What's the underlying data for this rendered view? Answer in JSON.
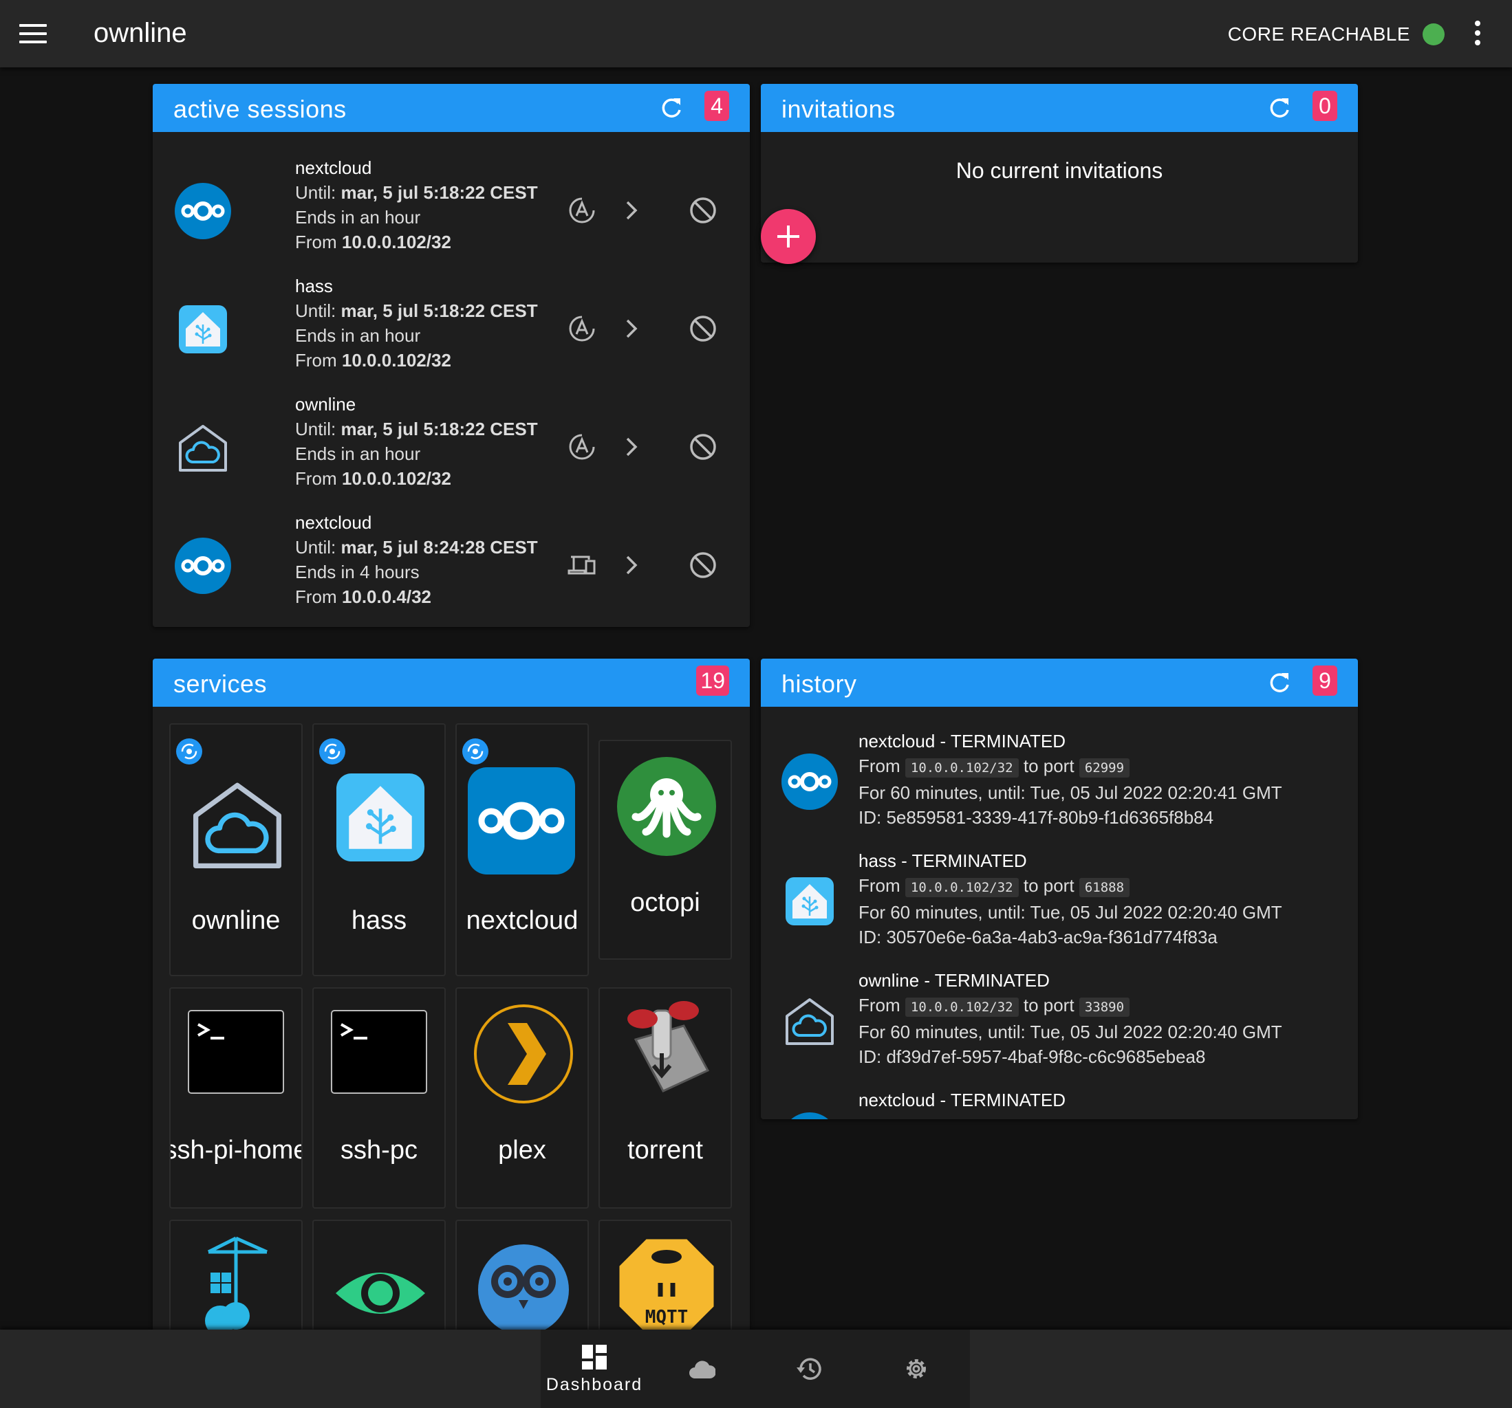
{
  "app": {
    "title": "ownline",
    "status": "CORE REACHABLE",
    "status_color": "#4caf50"
  },
  "colors": {
    "accent": "#2196f3",
    "badge": "#f0396e",
    "background": "#121212"
  },
  "active_sessions": {
    "title": "active sessions",
    "count": "4",
    "items": [
      {
        "name": "nextcloud",
        "until_label": "Until:",
        "until": "mar, 5 jul 5:18:22 CEST",
        "ends": "Ends in an hour",
        "from_label": "From",
        "from": "10.0.0.102/32",
        "icon": "nextcloud-icon",
        "type_icon": "auto-icon"
      },
      {
        "name": "hass",
        "until_label": "Until:",
        "until": "mar, 5 jul 5:18:22 CEST",
        "ends": "Ends in an hour",
        "from_label": "From",
        "from": "10.0.0.102/32",
        "icon": "home-assistant-icon",
        "type_icon": "auto-icon"
      },
      {
        "name": "ownline",
        "until_label": "Until:",
        "until": "mar, 5 jul 5:18:22 CEST",
        "ends": "Ends in an hour",
        "from_label": "From",
        "from": "10.0.0.102/32",
        "icon": "ownline-icon",
        "type_icon": "auto-icon"
      },
      {
        "name": "nextcloud",
        "until_label": "Until:",
        "until": "mar, 5 jul 8:24:28 CEST",
        "ends": "Ends in 4 hours",
        "from_label": "From",
        "from": "10.0.0.4/32",
        "icon": "nextcloud-icon",
        "type_icon": "devices-icon"
      }
    ]
  },
  "invitations": {
    "title": "invitations",
    "count": "0",
    "empty": "No current invitations"
  },
  "services": {
    "title": "services",
    "count": "19",
    "items": [
      {
        "name": "ownline",
        "icon": "ownline-icon"
      },
      {
        "name": "hass",
        "icon": "home-assistant-icon"
      },
      {
        "name": "nextcloud",
        "icon": "nextcloud-icon"
      },
      {
        "name": "octopi",
        "icon": "octopi-icon"
      },
      {
        "name": "ssh-pi-home",
        "icon": "terminal-icon"
      },
      {
        "name": "ssh-pc",
        "icon": "terminal-icon"
      },
      {
        "name": "plex",
        "icon": "plex-icon"
      },
      {
        "name": "torrent",
        "icon": "transmission-icon"
      },
      {
        "name": "",
        "icon": "docker-registry-icon"
      },
      {
        "name": "",
        "icon": "eye-icon"
      },
      {
        "name": "",
        "icon": "owl-icon"
      },
      {
        "name": "",
        "icon": "mqtt-icon",
        "logo_text": "MQTT"
      }
    ]
  },
  "history": {
    "title": "history",
    "count": "9",
    "items": [
      {
        "name": "nextcloud - TERMINATED",
        "from_label": "From",
        "from": "10.0.0.102/32",
        "port_label": "to port",
        "port": "62999",
        "duration": "For 60 minutes, until: Tue, 05 Jul 2022 02:20:41 GMT",
        "id": "ID: 5e859581-3339-417f-80b9-f1d6365f8b84",
        "icon": "nextcloud-icon"
      },
      {
        "name": "hass - TERMINATED",
        "from_label": "From",
        "from": "10.0.0.102/32",
        "port_label": "to port",
        "port": "61888",
        "duration": "For 60 minutes, until: Tue, 05 Jul 2022 02:20:40 GMT",
        "id": "ID: 30570e6e-6a3a-4ab3-ac9a-f361d774f83a",
        "icon": "home-assistant-icon"
      },
      {
        "name": "ownline - TERMINATED",
        "from_label": "From",
        "from": "10.0.0.102/32",
        "port_label": "to port",
        "port": "33890",
        "duration": "For 60 minutes, until: Tue, 05 Jul 2022 02:20:40 GMT",
        "id": "ID: df39d7ef-5957-4baf-9f8c-c6c9685ebea8",
        "icon": "ownline-icon"
      },
      {
        "name": "nextcloud - TERMINATED",
        "icon": "nextcloud-icon"
      }
    ]
  },
  "bottom_nav": [
    {
      "label": "Dashboard",
      "icon": "dashboard-icon"
    },
    {
      "label": "",
      "icon": "cloud-icon"
    },
    {
      "label": "",
      "icon": "history-icon"
    },
    {
      "label": "",
      "icon": "gear-icon"
    }
  ]
}
